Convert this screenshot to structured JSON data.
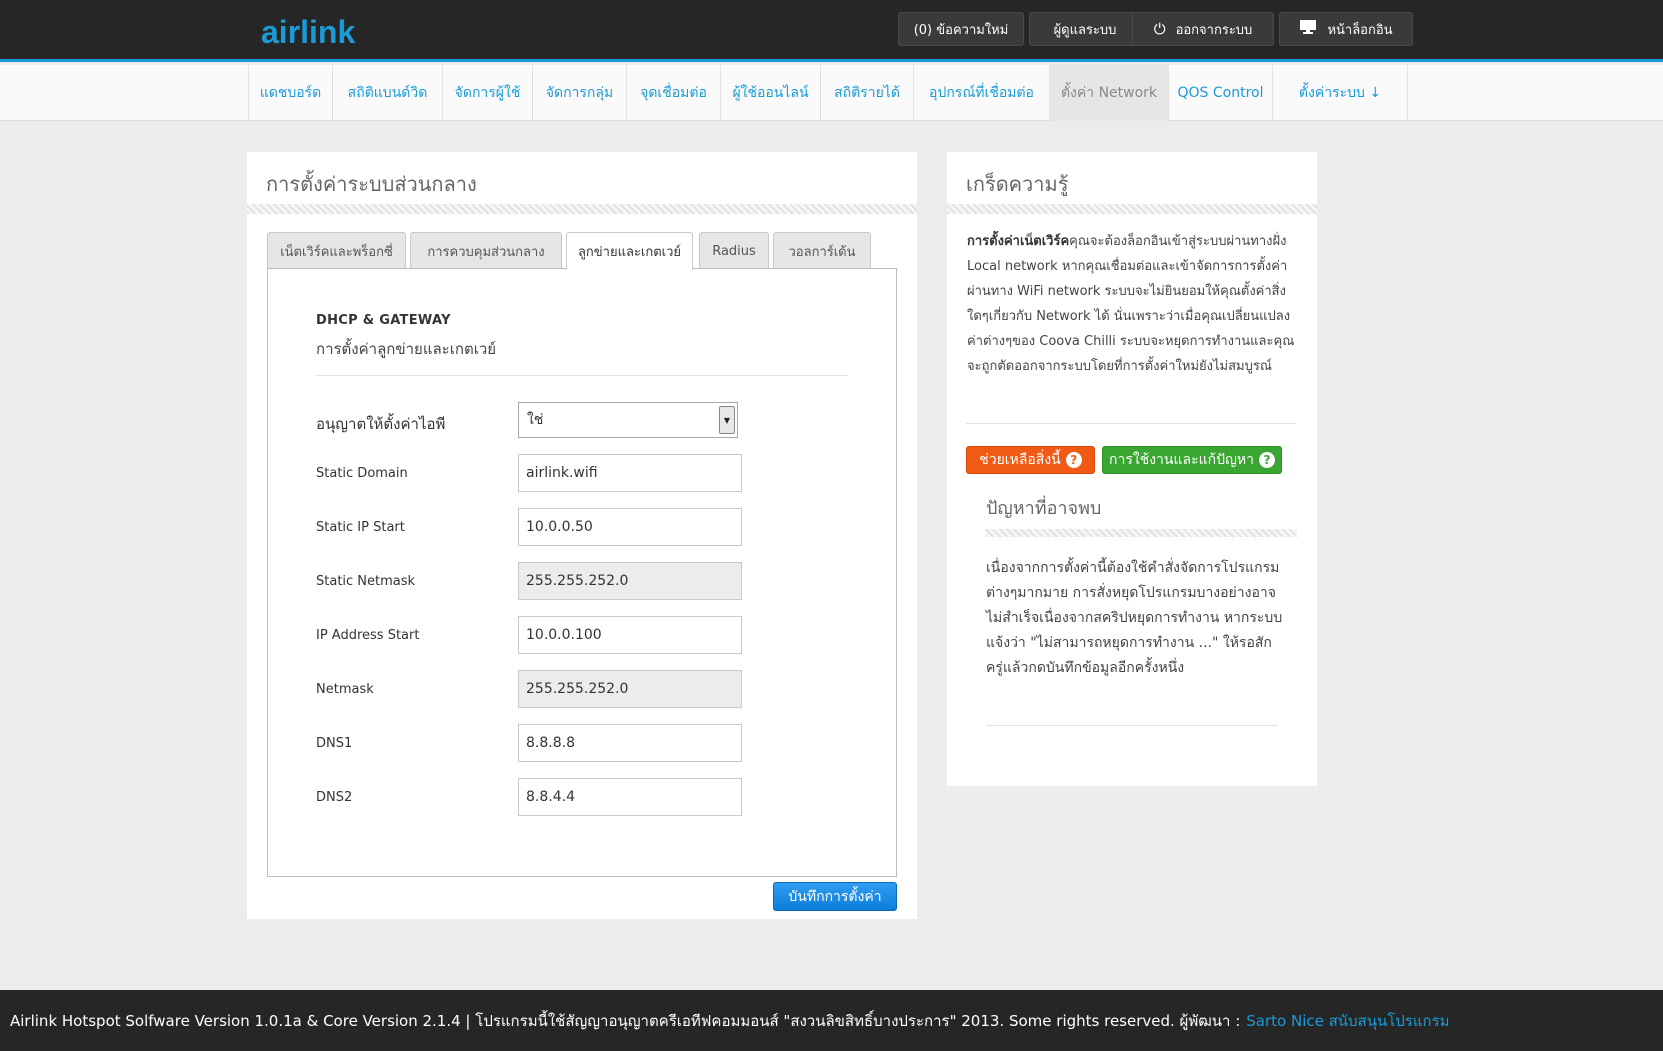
{
  "brand": {
    "logo": "airlink"
  },
  "topbar": {
    "messages": "(0) ข้อความใหม่",
    "admin": "ผู้ดูแลระบบ",
    "logout": "ออกจากระบบ",
    "login_page": "หน้าล็อกอิน"
  },
  "nav": {
    "items": [
      "แดชบอร์ด",
      "สถิติแบนด์วิด",
      "จัดการผู้ใช้",
      "จัดการกลุ่ม",
      "จุดเชื่อมต่อ",
      "ผู้ใช้ออนไลน์",
      "สถิติรายได้",
      "อุปกรณ์ที่เชื่อมต่อ",
      "ตั้งค่า Network",
      "QOS Control",
      "ตั้งค่าระบบ ↓"
    ],
    "active_index": 8
  },
  "main": {
    "title": "การตั้งค่าระบบส่วนกลาง",
    "tabs": [
      "เน็ตเวิร์คและพร็อกซี่",
      "การควบคุมส่วนกลาง",
      "ลูกข่ายและเกตเวย์",
      "Radius",
      "วอลการ์เด้น"
    ],
    "active_tab": 2,
    "section_title": "DHCP & GATEWAY",
    "section_subtitle": "การตั้งค่าลูกข่ายและเกตเวย์",
    "fields": {
      "allow_ip_label": "อนุญาตให้ตั้งค่าไอพี",
      "allow_ip_value": "ใช่",
      "static_domain_label": "Static Domain",
      "static_domain_value": "airlink.wifi",
      "static_ip_start_label": "Static IP Start",
      "static_ip_start_value": "10.0.0.50",
      "static_netmask_label": "Static Netmask",
      "static_netmask_value": "255.255.252.0",
      "ip_address_start_label": "IP Address Start",
      "ip_address_start_value": "10.0.0.100",
      "netmask_label": "Netmask",
      "netmask_value": "255.255.252.0",
      "dns1_label": "DNS1",
      "dns1_value": "8.8.8.8",
      "dns2_label": "DNS2",
      "dns2_value": "8.8.4.4"
    },
    "save_label": "บันทึกการตั้งค่า"
  },
  "tips": {
    "title": "เกร็ดความรู้",
    "bold_lead": "การตั้งค่าเน็ตเวิร์ค",
    "text": "คุณจะต้องล็อกอินเข้าสู่ระบบผ่านทางฝั่ง Local network หากคุณเชื่อมต่อและเข้าจัดการการตั้งค่าผ่านทาง WiFi network ระบบจะไม่ยินยอมให้คุณตั้งค่าสิ่งใดๆเกี่ยวกับ Network ได้ นั่นเพราะว่าเมื่อคุณเปลี่ยนแปลงค่าต่างๆของ Coova Chilli ระบบจะหยุดการทำงานและคุณจะถูกตัดออกจากระบบโดยที่การตั้งค่าใหม่ยังไม่สมบูรณ์",
    "help_label": "ช่วยเหลือสิ่งนี้",
    "usage_label": "การใช้งานและแก้ปัญหา",
    "problems_title": "ปัญหาที่อาจพบ",
    "problems_text": "เนื่องจากการตั้งค่านี้ต้องใช้คำสั่งจัดการโปรแกรมต่างๆมากมาย การสั่งหยุดโปรแกรมบางอย่างอาจไม่สำเร็จเนื่องจากสคริปหยุดการทำงาน หากระบบแจ้งว่า \"ไม่สามารถหยุดการทำงาน ...\" ให้รอสักครู่แล้วกดบันทึกข้อมูลอีกครั้งหนึ่ง"
  },
  "footer": {
    "text": "Airlink Hotspot Solfware Version 1.0.1a & Core Version 2.1.4 | โปรแกรมนี้ใช้สัญญาอนุญาตครีเอทีฟคอมมอนส์ \"สงวนลิขสิทธิ์บางประการ\" 2013. Some rights reserved. ผู้พัฒนา :",
    "link": "Sarto Nice สนับสนุนโปรแกรม"
  },
  "colors": {
    "accent": "#1a9bd7",
    "help_orange": "#f05a14",
    "usage_green": "#3aa632",
    "dark_bar": "#262626"
  }
}
